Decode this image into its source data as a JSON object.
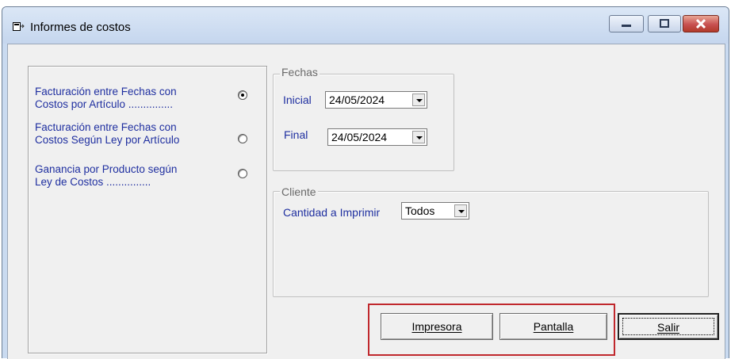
{
  "window": {
    "title": "Informes de costos"
  },
  "options": [
    {
      "line1": "Facturación entre Fechas con",
      "line2": "Costos por Artículo ...............",
      "selected": true
    },
    {
      "line1": "Facturación entre Fechas con",
      "line2": "Costos Según Ley por Artículo",
      "selected": false
    },
    {
      "line1": "Ganancia por Producto según",
      "line2": "Ley de Costos ...............",
      "selected": false
    }
  ],
  "fechas": {
    "legend": "Fechas",
    "inicial_label": "Inicial",
    "inicial_value": "24/05/2024",
    "final_label": "Final",
    "final_value": "24/05/2024"
  },
  "cliente": {
    "legend": "Cliente",
    "cantidad_label": "Cantidad a Imprimir",
    "cantidad_value": "Todos"
  },
  "buttons": {
    "impresora": "Impresora",
    "pantalla": "Pantalla",
    "salir": "Salir"
  },
  "colors": {
    "label_blue": "#1f2fa0",
    "highlight_red": "#c0282d"
  }
}
